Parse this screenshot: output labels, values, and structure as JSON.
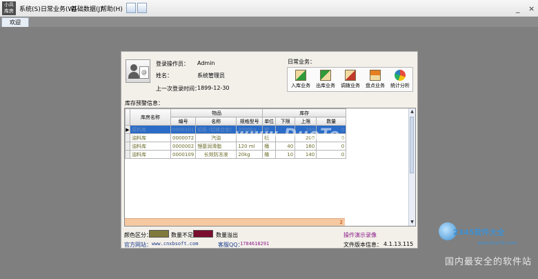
{
  "app": {
    "logo_line1": "小兵",
    "logo_line2": "库房"
  },
  "menu": [
    "系统(S)",
    "日常业务(W)",
    "基础数据(J)",
    "帮助(H)"
  ],
  "window_controls": [
    "_",
    "×"
  ],
  "tabs": [
    {
      "label": "欢迎"
    }
  ],
  "user": {
    "operator_label": "登录操作员：",
    "operator_value": "Admin",
    "name_label": "姓名：",
    "name_value": "系统管理员",
    "last_login_label": "上一次登录时间：",
    "last_login_value": "1899-12-30"
  },
  "daily": {
    "title": "日常业务：",
    "buttons": [
      {
        "label": "入库业务",
        "icon": "inbound-icon",
        "color": "#2e9a3a"
      },
      {
        "label": "出库业务",
        "icon": "outbound-icon",
        "color": "#2e9a3a"
      },
      {
        "label": "调拨业务",
        "icon": "transfer-icon",
        "color": "#c0392b"
      },
      {
        "label": "盘点业务",
        "icon": "inventory-check-icon",
        "color": "#e67e22"
      },
      {
        "label": "统计分析",
        "icon": "pie-chart-icon",
        "color": "#d35400"
      }
    ]
  },
  "alert": {
    "title": "库存预警信息：",
    "group_headers": {
      "goods": "物品",
      "stock": "库存"
    },
    "columns": {
      "warehouse": "库房名称",
      "code": "编号",
      "name": "名称",
      "spec": "规格型号",
      "unit": "单位",
      "lower": "下限",
      "upper": "上限",
      "qty": "数量"
    },
    "rows": [
      {
        "warehouse": "原料库",
        "code": "0000101",
        "name": "铝板 (铝镁合金)",
        "spec": "2000kg",
        "unit": "吨",
        "lower": "",
        "upper": "200",
        "qty": "0"
      },
      {
        "warehouse": "油料库",
        "code": "0000072",
        "name": "汽油",
        "spec": "",
        "unit": "桶",
        "lower": "",
        "upper": "200",
        "qty": "0"
      },
      {
        "warehouse": "油料库",
        "code": "0000002",
        "name": "锂基润滑脂",
        "spec": "120 ml",
        "unit": "桶",
        "lower": "40",
        "upper": "160",
        "qty": "0"
      },
      {
        "warehouse": "油料库",
        "code": "0000109",
        "name": "长效防冻液",
        "spec": "20kg",
        "unit": "桶",
        "lower": "10",
        "upper": "140",
        "qty": "0"
      }
    ],
    "sum_value": "2",
    "selected_row_marker": "▶"
  },
  "legend": {
    "title": "颜色区分：",
    "items": [
      {
        "label": "数量不足",
        "color": "#7f7a3c"
      },
      {
        "label": "数量溢出",
        "color": "#7a0d2e"
      }
    ]
  },
  "footer": {
    "website_label": "官方网站：",
    "website_value": "www.cnxbsoft.com",
    "qq_label": "客服QQ：",
    "qq_value": "1784618291",
    "demo_link": "操作演示录像",
    "version_label": "文件版本信息：",
    "version_value": "4.1.13.115"
  },
  "watermarks": {
    "center": "www.DuoTe.com",
    "brand": "2345软件大全",
    "site": "www.DuoTe.com",
    "bottom": "国内最安全的软件站"
  }
}
